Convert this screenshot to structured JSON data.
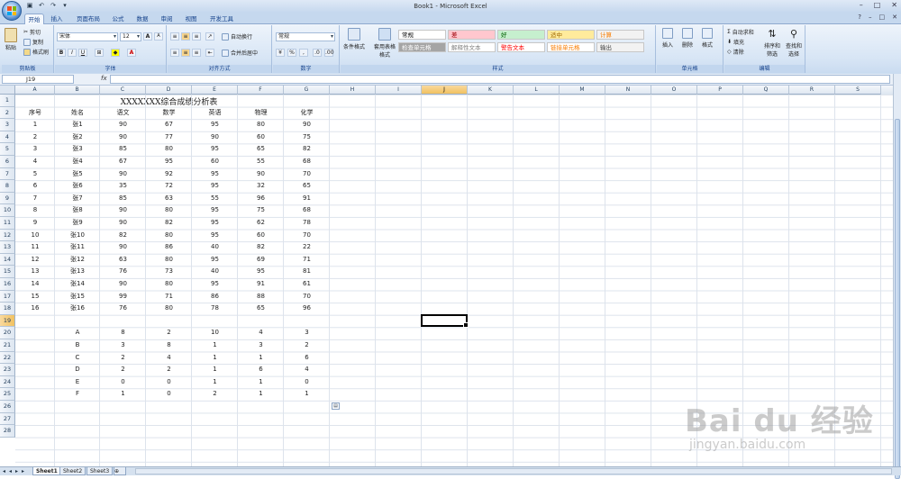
{
  "window": {
    "title": "Book1 - Microsoft Excel",
    "buttons": [
      "–",
      "□",
      "✕"
    ]
  },
  "tabs": [
    "开始",
    "插入",
    "页面布局",
    "公式",
    "数据",
    "审阅",
    "视图",
    "开发工具"
  ],
  "active_tab": "开始",
  "ribbon": {
    "clipboard": {
      "label": "剪贴板",
      "paste": "粘贴",
      "cut": "剪切",
      "copy": "复制",
      "format_painter": "格式刷"
    },
    "font": {
      "label": "字体",
      "name": "宋体",
      "size": "12",
      "bold": "B",
      "italic": "I",
      "underline": "U",
      "grow": "A",
      "shrink": "A"
    },
    "alignment": {
      "label": "对齐方式",
      "wrap": "自动换行",
      "merge": "合并后居中"
    },
    "number": {
      "label": "数字",
      "format": "常规",
      "percent": "%"
    },
    "styles": {
      "label": "样式",
      "cond_format": "条件格式",
      "table_format": "套用表格格式",
      "cells": [
        {
          "text": "常规",
          "bg": "#ffffff",
          "fg": "#000000"
        },
        {
          "text": "差",
          "bg": "#ffc7ce",
          "fg": "#9c0006"
        },
        {
          "text": "好",
          "bg": "#c6efce",
          "fg": "#006100"
        },
        {
          "text": "适中",
          "bg": "#ffeb9c",
          "fg": "#9c6500"
        },
        {
          "text": "计算",
          "bg": "#f2f2f2",
          "fg": "#fa7d00"
        },
        {
          "text": "检查单元格",
          "bg": "#a5a5a5",
          "fg": "#ffffff"
        },
        {
          "text": "解释性文本",
          "bg": "#ffffff",
          "fg": "#7f7f7f"
        },
        {
          "text": "警告文本",
          "bg": "#ffffff",
          "fg": "#ff0000"
        },
        {
          "text": "链接单元格",
          "bg": "#ffffff",
          "fg": "#fa7d00"
        },
        {
          "text": "输出",
          "bg": "#f2f2f2",
          "fg": "#3f3f3f"
        }
      ]
    },
    "cells": {
      "label": "单元格",
      "insert": "插入",
      "delete": "删除",
      "format": "格式"
    },
    "editing": {
      "label": "编辑",
      "autosum": "自动求和",
      "fill": "填充",
      "clear": "清除",
      "sort": "排序和筛选",
      "find": "查找和选择"
    }
  },
  "formula_bar": {
    "name_box": "J19",
    "fx": "fx",
    "value": ""
  },
  "columns": [
    "A",
    "B",
    "C",
    "D",
    "E",
    "F",
    "G",
    "H",
    "I",
    "J",
    "K",
    "L",
    "M",
    "N",
    "O",
    "P",
    "Q",
    "R",
    "S"
  ],
  "selected_column": "J",
  "rows": [
    "1",
    "2",
    "3",
    "4",
    "5",
    "6",
    "7",
    "8",
    "9",
    "10",
    "11",
    "12",
    "13",
    "14",
    "15",
    "16",
    "17",
    "18",
    "19",
    "20",
    "21",
    "22",
    "23",
    "24",
    "25",
    "26",
    "27",
    "28"
  ],
  "selected_row": "19",
  "sheet": {
    "title": "XXXXXXX综合成绩分析表",
    "headers": [
      "序号",
      "姓名",
      "语文",
      "数学",
      "英语",
      "物理",
      "化学"
    ],
    "data": [
      [
        "1",
        "张1",
        "90",
        "67",
        "95",
        "80",
        "90"
      ],
      [
        "2",
        "张2",
        "90",
        "77",
        "90",
        "60",
        "75"
      ],
      [
        "3",
        "张3",
        "85",
        "80",
        "95",
        "65",
        "82"
      ],
      [
        "4",
        "张4",
        "67",
        "95",
        "60",
        "55",
        "68"
      ],
      [
        "5",
        "张5",
        "90",
        "92",
        "95",
        "90",
        "70"
      ],
      [
        "6",
        "张6",
        "35",
        "72",
        "95",
        "32",
        "65"
      ],
      [
        "7",
        "张7",
        "85",
        "63",
        "55",
        "96",
        "91"
      ],
      [
        "8",
        "张8",
        "90",
        "80",
        "95",
        "75",
        "68"
      ],
      [
        "9",
        "张9",
        "90",
        "82",
        "95",
        "62",
        "78"
      ],
      [
        "10",
        "张10",
        "82",
        "80",
        "95",
        "60",
        "70"
      ],
      [
        "11",
        "张11",
        "90",
        "86",
        "40",
        "82",
        "22"
      ],
      [
        "12",
        "张12",
        "63",
        "80",
        "95",
        "69",
        "71"
      ],
      [
        "13",
        "张13",
        "76",
        "73",
        "40",
        "95",
        "81"
      ],
      [
        "14",
        "张14",
        "90",
        "80",
        "95",
        "91",
        "61"
      ],
      [
        "15",
        "张15",
        "99",
        "71",
        "86",
        "88",
        "70"
      ],
      [
        "16",
        "张16",
        "76",
        "80",
        "78",
        "65",
        "96"
      ]
    ],
    "summary": [
      [
        "A",
        "8",
        "2",
        "10",
        "4",
        "3"
      ],
      [
        "B",
        "3",
        "8",
        "1",
        "3",
        "2"
      ],
      [
        "C",
        "2",
        "4",
        "1",
        "1",
        "6"
      ],
      [
        "D",
        "2",
        "2",
        "1",
        "6",
        "4"
      ],
      [
        "E",
        "0",
        "0",
        "1",
        "1",
        "0"
      ],
      [
        "F",
        "1",
        "0",
        "2",
        "1",
        "1"
      ]
    ]
  },
  "sheet_tabs": [
    "Sheet1",
    "Sheet2",
    "Sheet3"
  ],
  "active_sheet": "Sheet1",
  "watermark": {
    "logo": "Bai du 经验",
    "url": "jingyan.baidu.com"
  }
}
